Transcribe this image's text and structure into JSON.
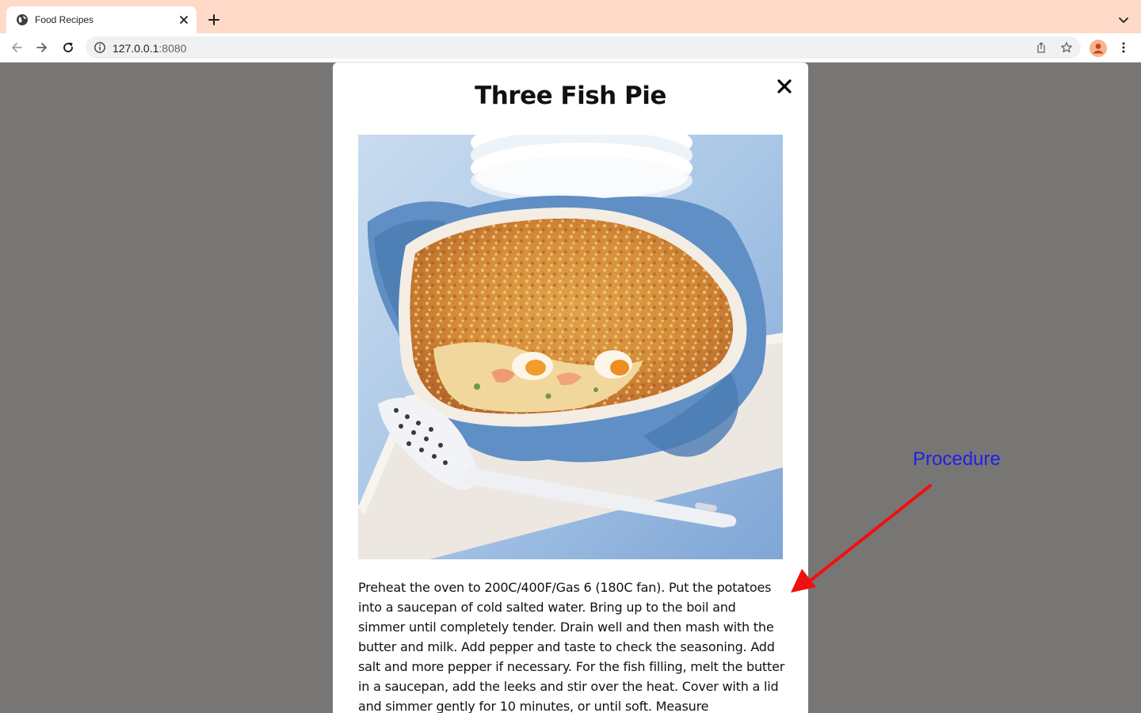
{
  "browser": {
    "tab_title": "Food Recipes",
    "url_host": "127.0.0.1",
    "url_port": ":8080",
    "icons": [
      "globe-icon",
      "close-icon",
      "plus-icon",
      "chevron-down-icon",
      "back-icon",
      "forward-icon",
      "reload-icon",
      "info-icon",
      "share-icon",
      "star-icon",
      "profile-icon",
      "more-icon"
    ]
  },
  "modal": {
    "title": "Three Fish Pie",
    "close_icon": "close-icon",
    "image_subject": "fish-pie-photo",
    "procedure": "Preheat the oven to 200C/400F/Gas 6 (180C fan). Put the potatoes into a saucepan of cold salted water. Bring up to the boil and simmer until completely tender. Drain well and then mash with the butter and milk. Add pepper and taste to check the seasoning. Add salt and more pepper if necessary. For the fish filling, melt the butter in a saucepan, add the leeks and stir over the heat. Cover with a lid and simmer gently for 10 minutes, or until soft. Measure"
  },
  "annotation": {
    "label": "Procedure",
    "label_color": "#2020e6",
    "arrow_color": "#f01010"
  },
  "colors": {
    "tabstrip": "#ffdac8",
    "backdrop": "#777675",
    "modal": "#ffffff"
  }
}
